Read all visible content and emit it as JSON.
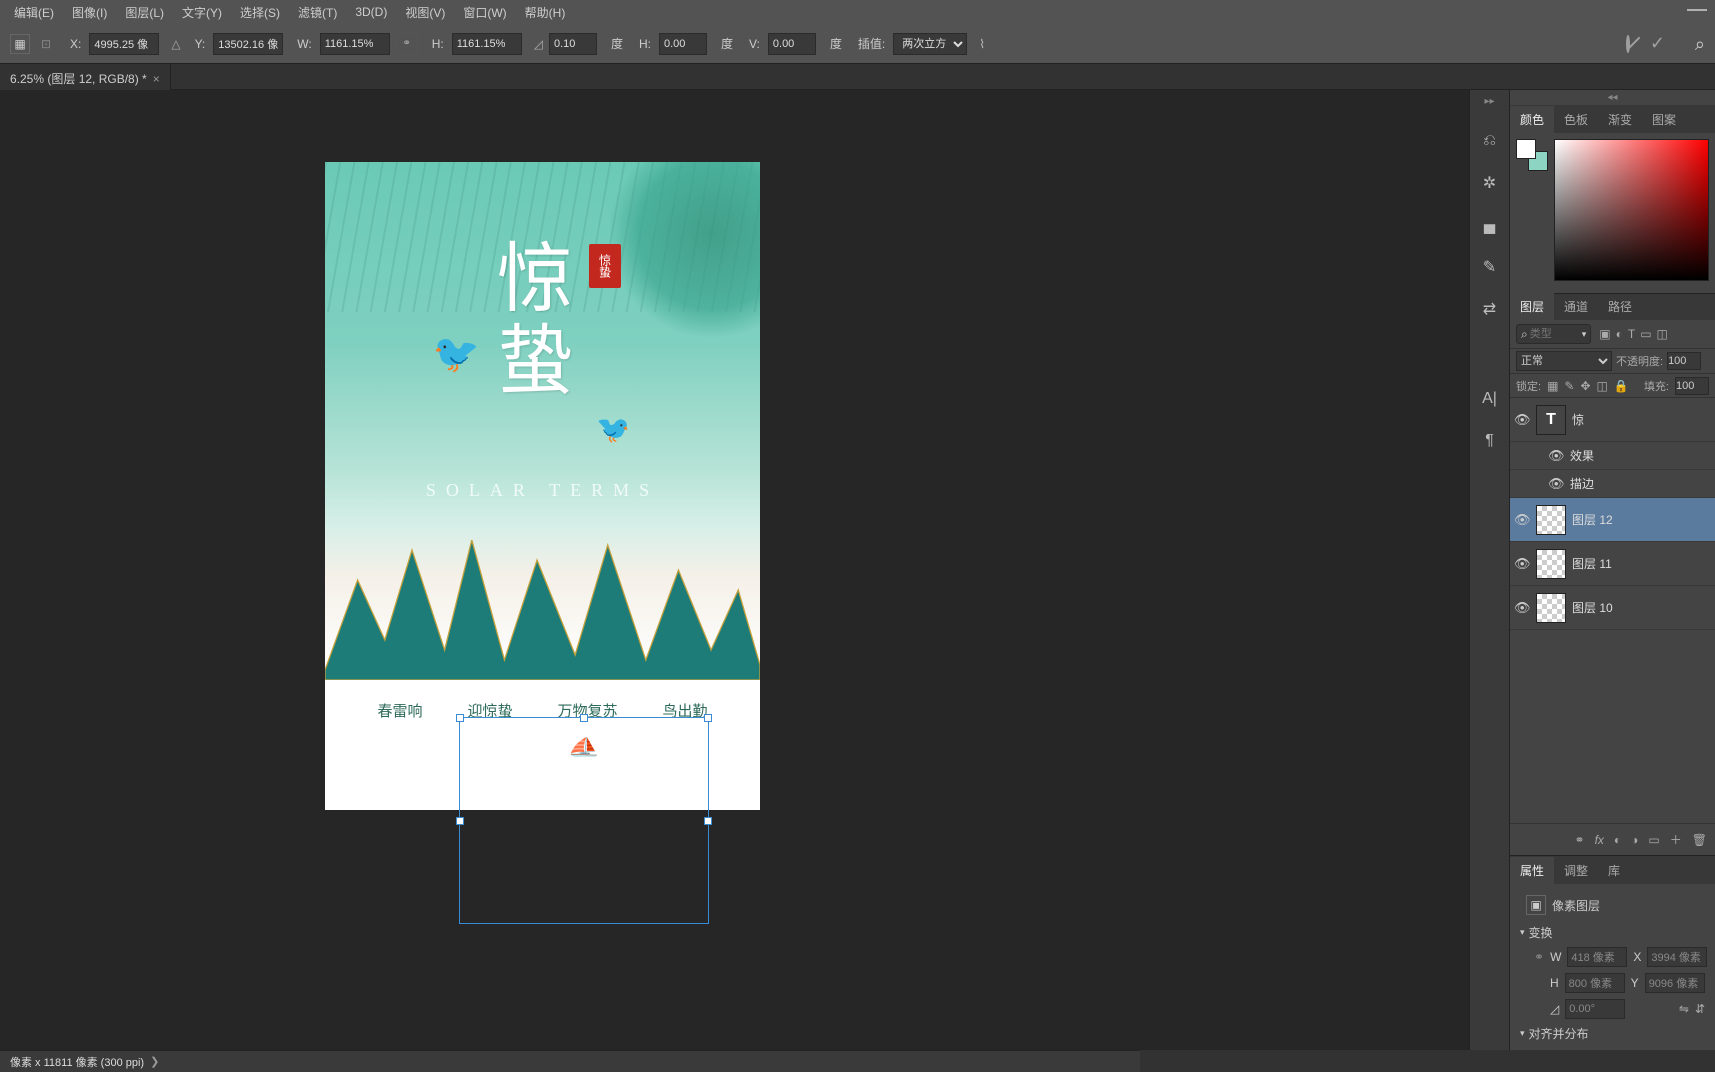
{
  "menu": [
    "编辑(E)",
    "图像(I)",
    "图层(L)",
    "文字(Y)",
    "选择(S)",
    "滤镜(T)",
    "3D(D)",
    "视图(V)",
    "窗口(W)",
    "帮助(H)"
  ],
  "options": {
    "x_label": "X:",
    "x": "4995.25 像",
    "y_label": "Y:",
    "y": "13502.16 像",
    "w_label": "W:",
    "w": "1161.15%",
    "h_label": "H:",
    "h": "1161.15%",
    "angle": "0.10",
    "angle_unit": "度",
    "shear_h_label": "H:",
    "shear_h": "0.00",
    "shear_h_unit": "度",
    "shear_v_label": "V:",
    "shear_v": "0.00",
    "shear_v_unit": "度",
    "interp_label": "插值:",
    "interp": "两次立方"
  },
  "doc_tab": "6.25% (图层 12, RGB/8) *",
  "artwork": {
    "title_char1": "惊",
    "title_char2": "蛰",
    "seal": "惊蛰",
    "subtitle": "SOLAR TERMS",
    "captions": [
      "春雷响",
      "迎惊蛰",
      "万物复苏",
      "鸟出勤"
    ]
  },
  "panels": {
    "color_tabs": [
      "颜色",
      "色板",
      "渐变",
      "图案"
    ],
    "layers_tabs": [
      "图层",
      "通道",
      "路径"
    ],
    "search_placeholder": "类型",
    "blend_mode": "正常",
    "opacity_label": "不透明度:",
    "opacity": "100",
    "lock_label": "锁定:",
    "fill_label": "填充:",
    "fill": "100",
    "layers": [
      {
        "type": "text",
        "name": "惊",
        "sub": [
          {
            "name": "效果"
          },
          {
            "name": "描边"
          }
        ]
      },
      {
        "type": "pixel",
        "name": "图层 12",
        "selected": true
      },
      {
        "type": "pixel",
        "name": "图层 11"
      },
      {
        "type": "pixel",
        "name": "图层 10"
      }
    ],
    "props_tabs": [
      "属性",
      "调整",
      "库"
    ],
    "props_kind": "像素图层",
    "transform_header": "变换",
    "w_label": "W",
    "w_value": "418 像素",
    "x_label": "X",
    "x_value": "3994 像素",
    "h_label": "H",
    "h_value": "800 像素",
    "y_label": "Y",
    "y_value": "9096 像素",
    "rot_value": "0.00°",
    "align_header": "对齐并分布"
  },
  "status": "像素 x 11811 像素 (300 ppi)"
}
